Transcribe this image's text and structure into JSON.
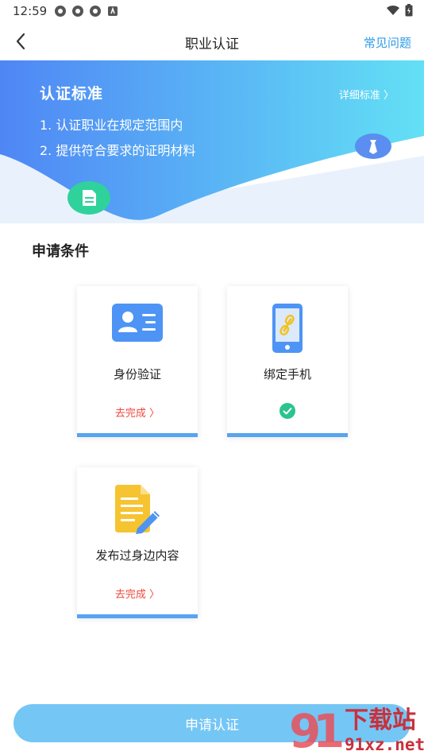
{
  "status": {
    "time": "12:59"
  },
  "nav": {
    "title": "职业认证",
    "faq": "常见问题"
  },
  "banner": {
    "title": "认证标准",
    "items": [
      "1. 认证职业在规定范围内",
      "2. 提供符合要求的证明材料"
    ],
    "detail": "详细标准 〉"
  },
  "section": {
    "title": "申请条件"
  },
  "cards": [
    {
      "label": "身份验证",
      "action": "去完成 〉"
    },
    {
      "label": "绑定手机",
      "status": "completed"
    },
    {
      "label": "发布过身边内容",
      "action": "去完成 〉"
    }
  ],
  "apply": {
    "label": "申请认证"
  },
  "watermark": {
    "text": "下载站",
    "url": "91xz.net"
  },
  "colors": {
    "accent": "#2f9be8",
    "card_bar": "#57a4f0",
    "action_red": "#ec4a3c",
    "button": "#74c6f5",
    "check_green": "#2bc48e"
  }
}
